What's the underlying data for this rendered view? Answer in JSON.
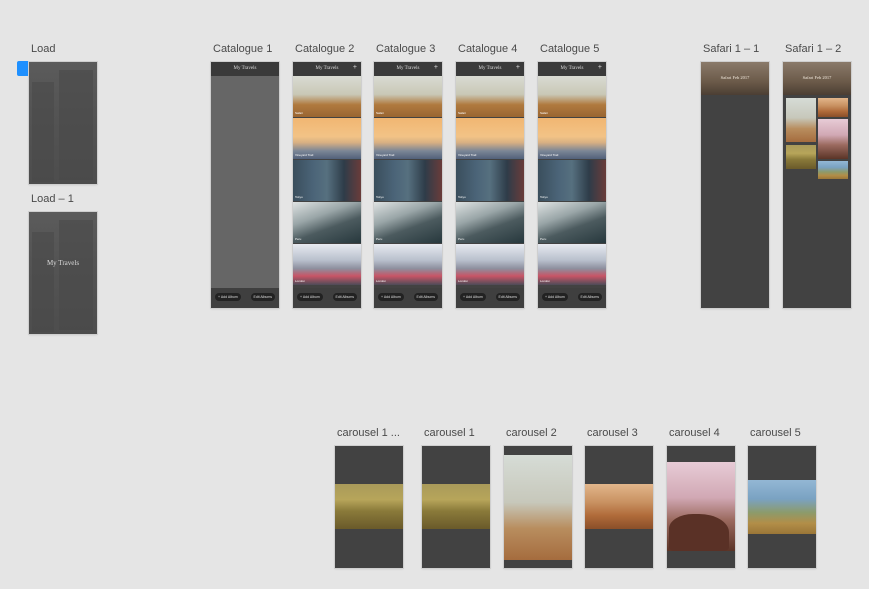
{
  "labels": {
    "load": "Load",
    "load_1": "Load – 1",
    "catalogue_1": "Catalogue 1",
    "catalogue_2": "Catalogue 2",
    "catalogue_3": "Catalogue 3",
    "catalogue_4": "Catalogue 4",
    "catalogue_5": "Catalogue 5",
    "safari_1_1": "Safari 1 – 1",
    "safari_1_2": "Safari 1 – 2",
    "carousel_1_trunc": "carousel 1 ...",
    "carousel_1": "carousel 1",
    "carousel_2": "carousel 2",
    "carousel_3": "carousel 3",
    "carousel_4": "carousel 4",
    "carousel_5": "carousel 5"
  },
  "load_screen": {
    "title": "My Travels"
  },
  "catalogue": {
    "title": "My Travels",
    "add_album": "+ Add Album",
    "edit_albums": "Edit Albums",
    "tiles": [
      "Safari",
      "Vineyard Trail",
      "Tokyo",
      "Peru",
      "London"
    ]
  },
  "safari": {
    "hero_title": "Safari Feb 2017"
  }
}
